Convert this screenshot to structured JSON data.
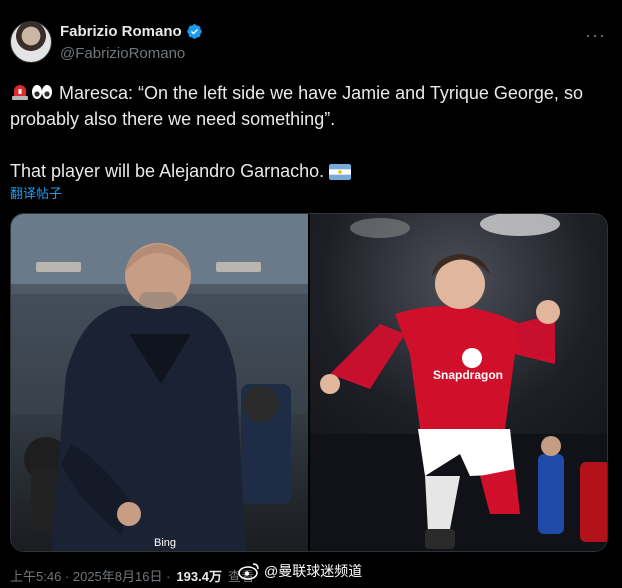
{
  "author": {
    "name": "Fabrizio Romano",
    "handle": "@FabrizioRomano",
    "more_label": "···"
  },
  "tweet": {
    "line1": "Maresca: “On the left side we have Jamie and Tyrique George, so",
    "line2": "probably also there we need something”.",
    "line3": "That player will be Alejandro Garnacho.",
    "translate_label": "翻译帖子"
  },
  "media": {
    "left": {
      "badge_text": "Bing"
    },
    "right": {
      "sponsor_text": "Snapdragon"
    }
  },
  "footer": {
    "time": "上午5:46 · 2025年8月16日 ·",
    "views_count": "193.4万",
    "views_label": "查看"
  },
  "watermark": {
    "text": "@曼联球迷频道"
  },
  "colors": {
    "background": "#000000",
    "text": "#e7e9ea",
    "muted": "#71767b",
    "link": "#1d9bf0",
    "verified": "#1d9bf0"
  }
}
